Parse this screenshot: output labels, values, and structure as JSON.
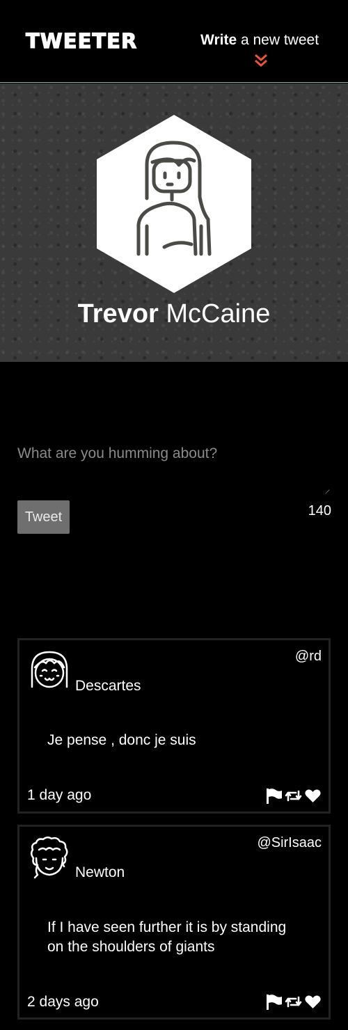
{
  "nav": {
    "brand": "TWEETER",
    "compose_bold": "Write",
    "compose_rest": " a new tweet"
  },
  "profile": {
    "first_name": "Trevor",
    "last_name": "McCaine"
  },
  "composer": {
    "placeholder": "What are you humming about?",
    "value": "",
    "button_label": "Tweet",
    "counter": "140"
  },
  "tweets": [
    {
      "handle": "@rd",
      "author": "Descartes",
      "text": "Je pense , donc je suis",
      "time": "1 day ago",
      "avatar_icon": "girl-avatar-icon"
    },
    {
      "handle": "@SirIsaac",
      "author": "Newton",
      "text": "If I have seen further it is by standing on the shoulders of giants",
      "time": "2 days ago",
      "avatar_icon": "curly-hair-avatar-icon"
    }
  ],
  "icons": {
    "flag": "flag-icon",
    "retweet": "retweet-icon",
    "like": "heart-icon",
    "expand": "double-chevron-down-icon"
  },
  "colors": {
    "background": "#000000",
    "accent": "#e8553d",
    "nav_border": "#8fb3b3",
    "button": "#6f6f6f"
  }
}
